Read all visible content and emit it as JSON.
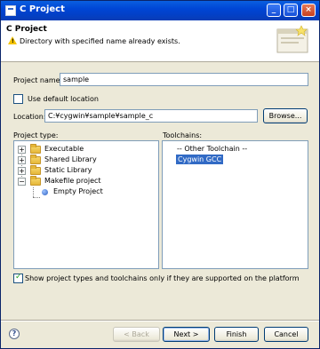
{
  "window": {
    "title": "C Project",
    "controls": {
      "minimize": "_",
      "maximize": "□",
      "close": "×"
    }
  },
  "header": {
    "title": "C Project",
    "message": "Directory with specified name already exists.",
    "icon": "warning-icon"
  },
  "form": {
    "project_name_label": "Project name:",
    "project_name_value": "sample",
    "use_default_location_label": "Use default location",
    "use_default_location_checked": false,
    "location_label": "Location:",
    "location_value": "C:¥cygwin¥sample¥sample_c",
    "browse_label": "Browse..."
  },
  "project_type": {
    "label": "Project type:",
    "items": [
      {
        "label": "Executable",
        "icon": "folder-icon",
        "expander": "+"
      },
      {
        "label": "Shared Library",
        "icon": "folder-icon",
        "expander": "+"
      },
      {
        "label": "Static Library",
        "icon": "folder-icon",
        "expander": "+"
      },
      {
        "label": "Makefile project",
        "icon": "folder-icon",
        "expander": "−"
      },
      {
        "label": "Empty Project",
        "icon": "bullet-icon",
        "expander": ""
      }
    ]
  },
  "toolchains": {
    "label": "Toolchains:",
    "items": [
      {
        "label": "-- Other Toolchain --",
        "selected": false
      },
      {
        "label": "Cygwin GCC",
        "selected": true
      }
    ]
  },
  "platform_filter": {
    "label": "Show project types and toolchains only if they are supported on the platform",
    "checked": true
  },
  "buttons": {
    "help": "?",
    "back": "< Back",
    "next": "Next >",
    "finish": "Finish",
    "cancel": "Cancel"
  }
}
